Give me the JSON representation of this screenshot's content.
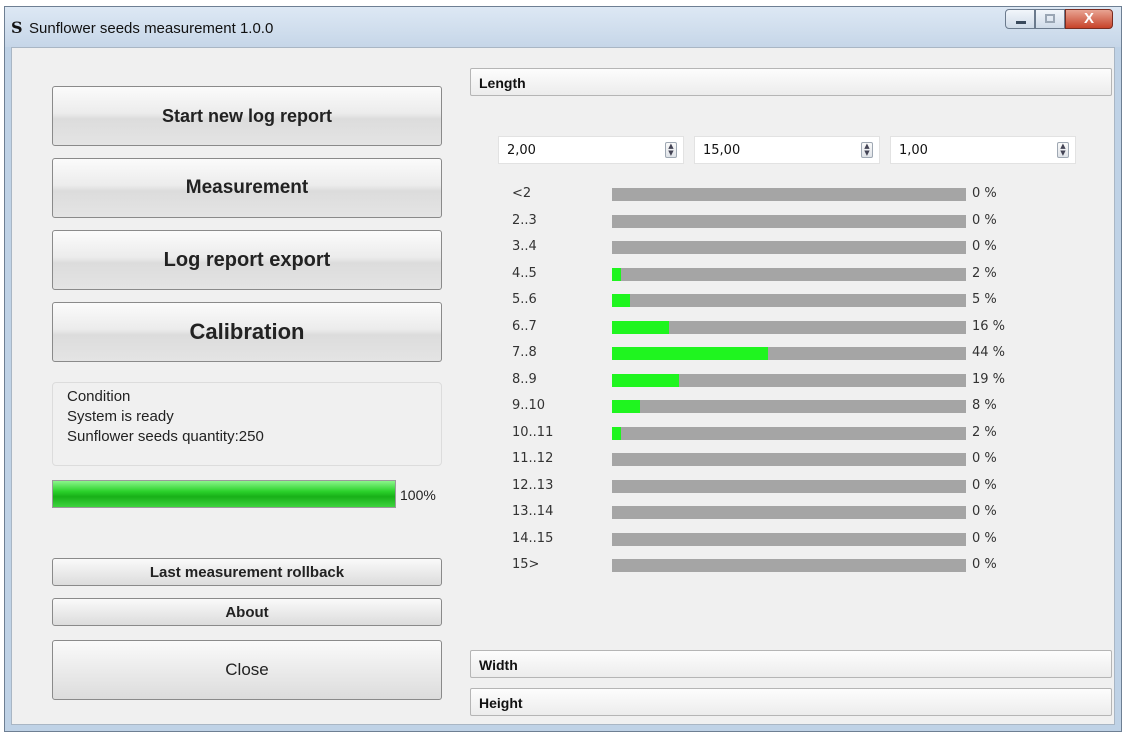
{
  "window": {
    "app_letter": "S",
    "title": "Sunflower seeds measurement 1.0.0",
    "close_glyph": "X"
  },
  "buttons": {
    "start_log": "Start new log report",
    "measurement": "Measurement",
    "export": "Log report export",
    "calibration": "Calibration",
    "rollback": "Last measurement rollback",
    "about": "About",
    "close": "Close"
  },
  "status": {
    "heading": "Condition",
    "line1": "System is ready",
    "line2": "Sunflower seeds quantity:250"
  },
  "progress": {
    "value": 1.0,
    "text": "100%"
  },
  "sections": {
    "length": "Length",
    "width": "Width",
    "height": "Height"
  },
  "spinners": [
    "2,00",
    "15,00",
    "1,00"
  ],
  "histogram": [
    {
      "label": "<2",
      "value": 0,
      "pct": "0 %"
    },
    {
      "label": "2..3",
      "value": 0,
      "pct": "0 %"
    },
    {
      "label": "3..4",
      "value": 0,
      "pct": "0 %"
    },
    {
      "label": "4..5",
      "value": 2,
      "pct": "2 %"
    },
    {
      "label": "5..6",
      "value": 5,
      "pct": "5 %"
    },
    {
      "label": "6..7",
      "value": 16,
      "pct": "16 %"
    },
    {
      "label": "7..8",
      "value": 44,
      "pct": "44 %"
    },
    {
      "label": "8..9",
      "value": 19,
      "pct": "19 %"
    },
    {
      "label": "9..10",
      "value": 8,
      "pct": "8 %"
    },
    {
      "label": "10..11",
      "value": 2,
      "pct": "2 %"
    },
    {
      "label": "11..12",
      "value": 0,
      "pct": "0 %"
    },
    {
      "label": "12..13",
      "value": 0,
      "pct": "0 %"
    },
    {
      "label": "13..14",
      "value": 0,
      "pct": "0 %"
    },
    {
      "label": "14..15",
      "value": 0,
      "pct": "0 %"
    },
    {
      "label": "15>",
      "value": 0,
      "pct": "0 %"
    }
  ],
  "colors": {
    "bar_fill": "#1ff51f",
    "bar_track": "#a5a5a5",
    "progress": "#22c822"
  }
}
